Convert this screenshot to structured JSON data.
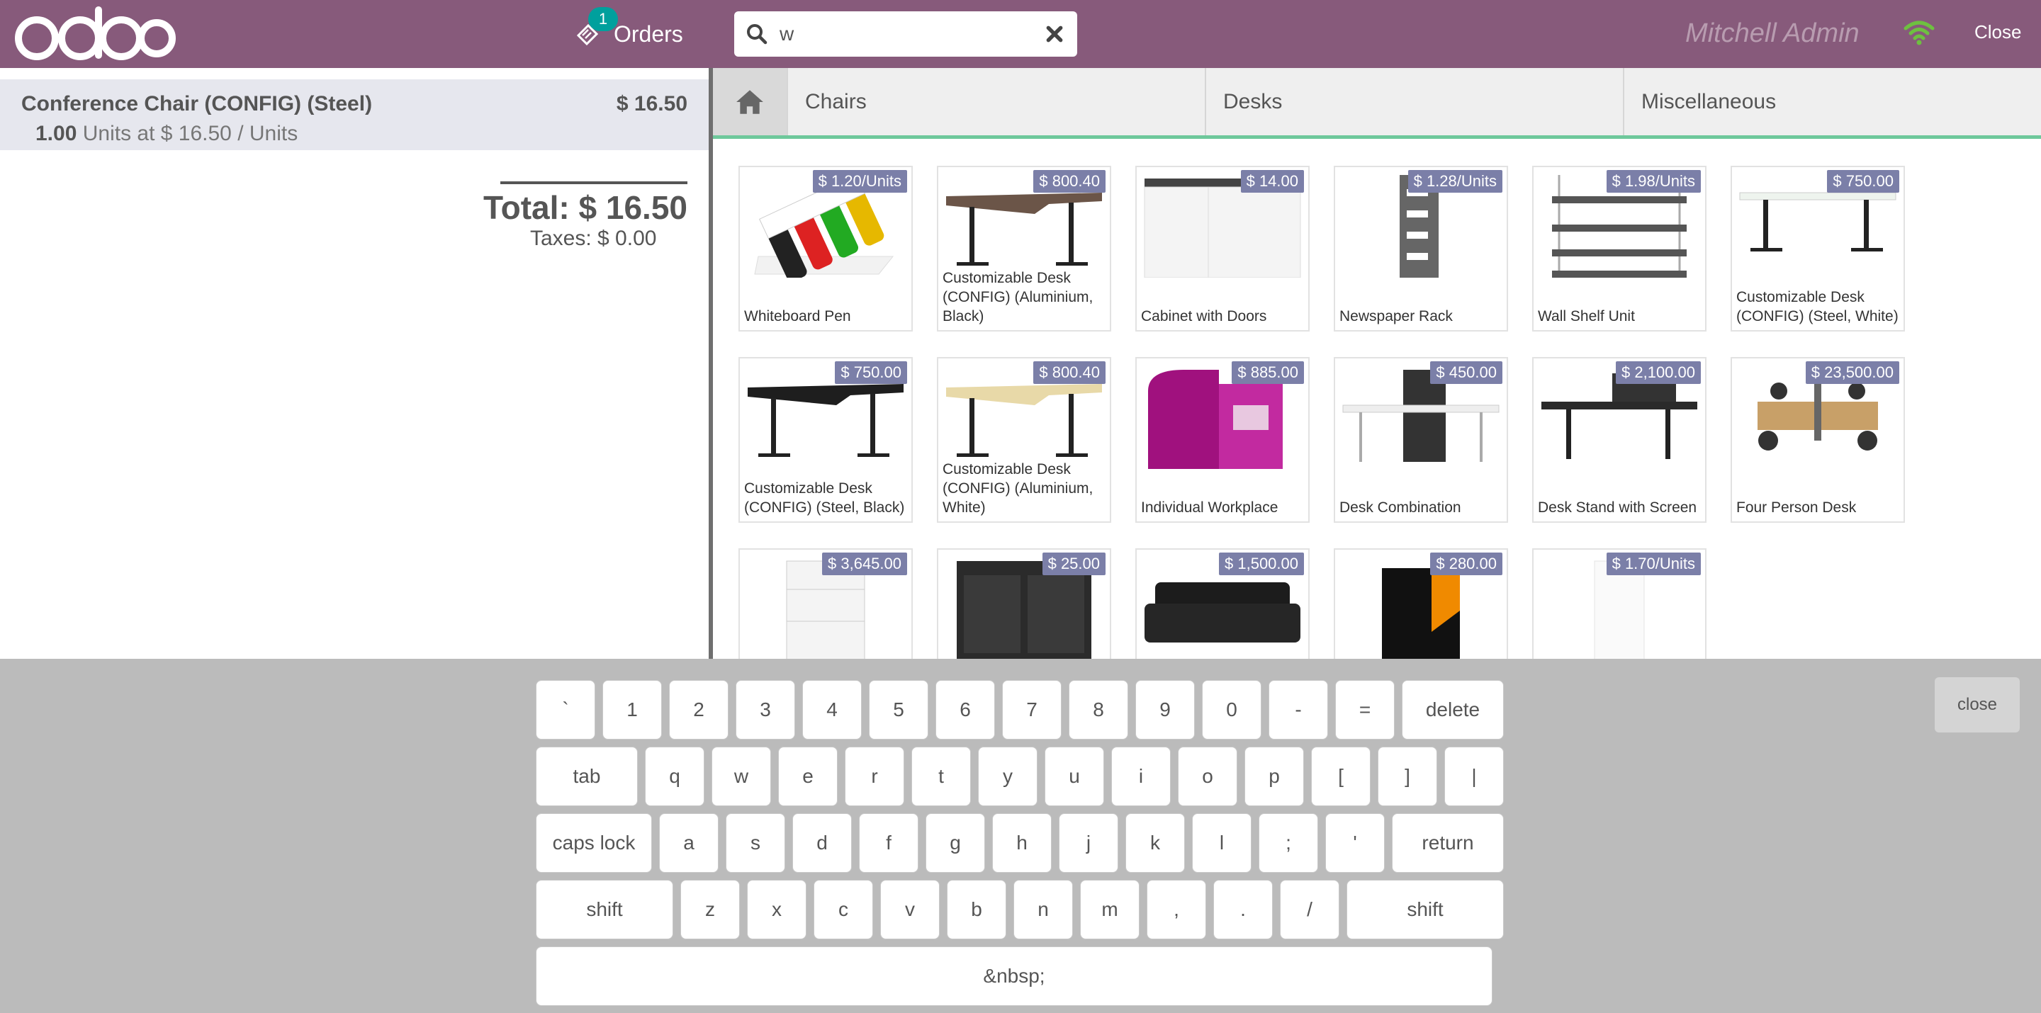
{
  "header": {
    "logo_text": "odoo",
    "orders_label": "Orders",
    "orders_count": "1",
    "search": {
      "value": "w",
      "placeholder": ""
    },
    "user_name": "Mitchell Admin",
    "close_label": "Close"
  },
  "order": {
    "line": {
      "product": "Conference Chair (CONFIG) (Steel)",
      "price": "$ 16.50",
      "qty": "1.00",
      "detail": " Units at $ 16.50 / Units"
    },
    "total": "Total: $ 16.50",
    "taxes": "Taxes: $ 0.00"
  },
  "categories": [
    "Chairs",
    "Desks",
    "Miscellaneous"
  ],
  "products": [
    {
      "name": "Whiteboard Pen",
      "price": "$ 1.20/Units",
      "icon": "whiteboard-pen"
    },
    {
      "name": "Customizable Desk (CONFIG) (Aluminium, Black)",
      "price": "$ 800.40",
      "icon": "desk-brown"
    },
    {
      "name": "Cabinet with Doors",
      "price": "$ 14.00",
      "icon": "cabinet"
    },
    {
      "name": "Newspaper Rack",
      "price": "$ 1.28/Units",
      "icon": "newspaper-rack"
    },
    {
      "name": "Wall Shelf Unit",
      "price": "$ 1.98/Units",
      "icon": "wall-shelf"
    },
    {
      "name": "Customizable Desk (CONFIG) (Steel, White)",
      "price": "$ 750.00",
      "icon": "desk-white"
    },
    {
      "name": "Customizable Desk (CONFIG) (Steel, Black)",
      "price": "$ 750.00",
      "icon": "desk-black"
    },
    {
      "name": "Customizable Desk (CONFIG) (Aluminium, White)",
      "price": "$ 800.40",
      "icon": "desk-beige"
    },
    {
      "name": "Individual Workplace",
      "price": "$ 885.00",
      "icon": "workplace-pod"
    },
    {
      "name": "Desk Combination",
      "price": "$ 450.00",
      "icon": "desk-combination"
    },
    {
      "name": "Desk Stand with Screen",
      "price": "$ 2,100.00",
      "icon": "desk-screen"
    },
    {
      "name": "Four Person Desk",
      "price": "$ 23,500.00",
      "icon": "four-person-desk"
    },
    {
      "name": "",
      "price": "$ 3,645.00",
      "icon": "drawer-unit"
    },
    {
      "name": "",
      "price": "$ 25.00",
      "icon": "dark-cabinet"
    },
    {
      "name": "",
      "price": "$ 1,500.00",
      "icon": "sofa"
    },
    {
      "name": "",
      "price": "$ 280.00",
      "icon": "software-box"
    },
    {
      "name": "",
      "price": "$ 1.70/Units",
      "icon": "white-item"
    }
  ],
  "keyboard": {
    "rows": [
      [
        "`",
        "1",
        "2",
        "3",
        "4",
        "5",
        "6",
        "7",
        "8",
        "9",
        "0",
        "-",
        "=",
        "delete"
      ],
      [
        "tab",
        "q",
        "w",
        "e",
        "r",
        "t",
        "y",
        "u",
        "i",
        "o",
        "p",
        "[",
        "]",
        "|"
      ],
      [
        "caps lock",
        "a",
        "s",
        "d",
        "f",
        "g",
        "h",
        "j",
        "k",
        "l",
        ";",
        "'",
        "return"
      ],
      [
        "shift",
        "z",
        "x",
        "c",
        "v",
        "b",
        "n",
        "m",
        ",",
        ".",
        "/",
        "shift"
      ],
      [
        "&nbsp;"
      ]
    ],
    "close_label": "close"
  },
  "colors": {
    "header": "#875a7b",
    "badge": "#00a09d",
    "price_tag": "#7b7fa8",
    "category_underline": "#6ec89b",
    "wifi": "#6ec040"
  }
}
